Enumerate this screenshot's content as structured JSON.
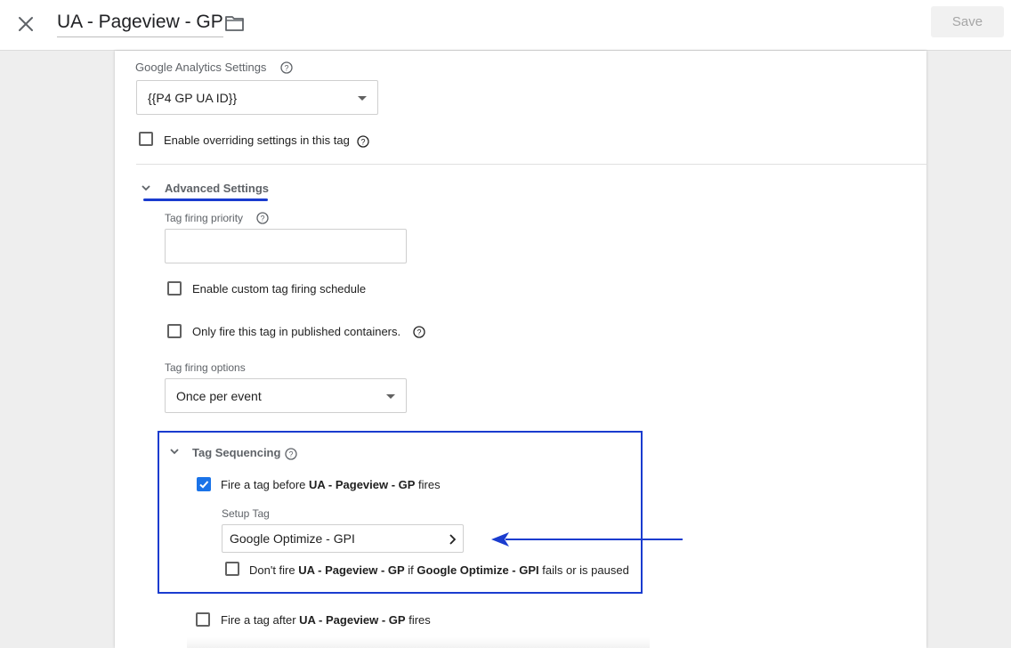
{
  "header": {
    "title": "UA - Pageview - GP",
    "save_label": "Save",
    "close_icon": "close-icon",
    "folder_icon": "folder-icon"
  },
  "ga_settings": {
    "label": "Google Analytics Settings",
    "selected_value": "{{P4 GP UA ID}}",
    "override_checkbox_label": "Enable overriding settings in this tag",
    "override_checked": false
  },
  "advanced": {
    "heading": "Advanced Settings",
    "priority_label": "Tag firing priority",
    "priority_value": "",
    "custom_schedule_label": "Enable custom tag firing schedule",
    "custom_schedule_checked": false,
    "published_only_label": "Only fire this tag in published containers.",
    "published_only_checked": false,
    "firing_options_label": "Tag firing options",
    "firing_options_value": "Once per event"
  },
  "sequencing": {
    "heading": "Tag Sequencing",
    "fire_before": {
      "prefix": "Fire a tag before ",
      "tag_name": "UA - Pageview - GP",
      "suffix": " fires",
      "checked": true
    },
    "setup_tag_label": "Setup Tag",
    "setup_tag_value": "Google Optimize - GPI",
    "dont_fire": {
      "prefix": "Don't fire ",
      "tag_name": "UA - Pageview - GP",
      "middle": " if ",
      "setup_name": "Google Optimize - GPI",
      "suffix": " fails or is paused",
      "checked": false
    },
    "fire_after": {
      "prefix": "Fire a tag after ",
      "tag_name": "UA - Pageview - GP",
      "suffix": " fires",
      "checked": false
    }
  },
  "annotation_colors": {
    "highlight": "#1a3ccf",
    "checkbox_accent": "#1a73e8"
  }
}
